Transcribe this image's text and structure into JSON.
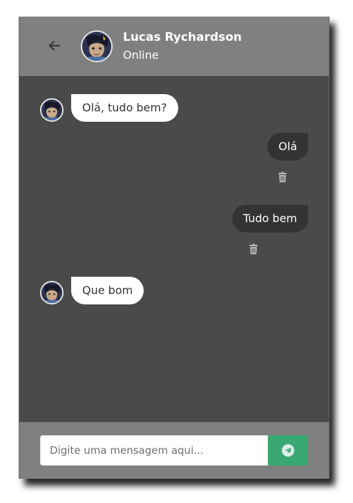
{
  "header": {
    "back_icon": "arrow-left-icon",
    "contact_name": "Lucas Rychardson",
    "contact_status": "Online"
  },
  "messages": [
    {
      "direction": "incoming",
      "text": "Olá, tudo bem?"
    },
    {
      "direction": "outgoing",
      "text": "Olá",
      "action_icon": "trash-icon"
    },
    {
      "direction": "outgoing",
      "text": "Tudo bem",
      "action_icon": "trash-icon"
    },
    {
      "direction": "incoming",
      "text": "Que bom"
    }
  ],
  "composer": {
    "placeholder": "Digite uma mensagem aqui...",
    "value": "",
    "send_icon": "paper-plane-icon"
  },
  "colors": {
    "header_bg": "#808080",
    "chat_bg": "#4a4a4a",
    "incoming_bubble": "#ffffff",
    "outgoing_bubble": "#333333",
    "send_button": "#3aa873"
  }
}
